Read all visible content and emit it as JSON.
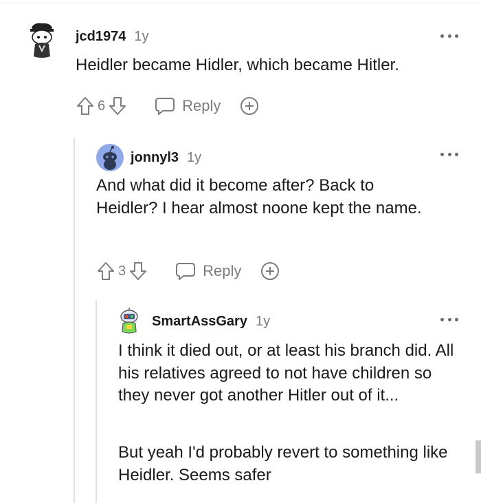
{
  "comments": [
    {
      "username": "jcd1974",
      "age": "1y",
      "text": "Heidler became Hidler, which became Hitler.",
      "votes": "6",
      "reply_label": "Reply",
      "avatar_icon": "snoo-avatar-black-hat"
    },
    {
      "username": "jonnyl3",
      "age": "1y",
      "text": "And what did it become after? Back to Heidler? I hear almost noone kept the name.",
      "votes": "3",
      "reply_label": "Reply",
      "avatar_icon": "snoo-avatar-default-blue"
    },
    {
      "username": "SmartAssGary",
      "age": "1y",
      "text_p1": "I think it died out, or at least his branch did. All his relatives agreed to not have children so they never got another Hitler out of it...",
      "text_p2": "But yeah I'd probably revert to something like Heidler. Seems safer",
      "avatar_icon": "snoo-avatar-robot-costume"
    }
  ],
  "colors": {
    "text": "#1a1a1b",
    "muted": "#7c7c7c",
    "thread_line": "#e0e0e0",
    "default_avatar_bg": "#8fa8e8"
  }
}
